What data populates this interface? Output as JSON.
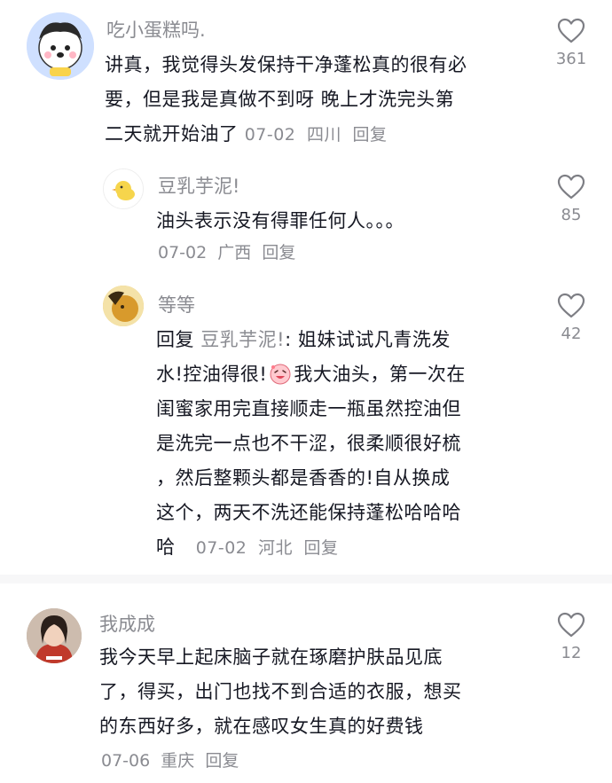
{
  "comments": [
    {
      "username": "吃小蛋糕吗.",
      "lines": [
        "讲真，我觉得头发保持干净蓬松真的很有必",
        "要，但是我是真做不到呀 晚上才洗完头第",
        "二天就开始油了"
      ],
      "date": "07-02",
      "location": "四川",
      "reply_label": "回复",
      "likes": "361"
    },
    {
      "username": "豆乳芋泥!",
      "lines": [
        "油头表示没有得罪任何人。。。"
      ],
      "date": "07-02",
      "location": "广西",
      "reply_label": "回复",
      "likes": "85"
    },
    {
      "username": "等等",
      "reply_prefix": "回复",
      "mention": "豆乳芋泥!",
      "lines": [
        ": 姐妹试试凡青洗发",
        "水!控油得很!",
        "我大油头，第一次在",
        "闺蜜家用完直接顺走一瓶虽然控油但",
        "是洗完一点也不干涩，很柔顺很好梳",
        "，然后整颗头都是香香的!自从换成",
        "这个，两天不洗还能保持蓬松哈哈哈",
        "哈"
      ],
      "date": "07-02",
      "location": "河北",
      "reply_label": "回复",
      "likes": "42"
    },
    {
      "username": "我成成",
      "lines": [
        "我今天早上起床脑子就在琢磨护肤品见底",
        "了，得买，出门也找不到合适的衣服，想买",
        "的东西好多，就在感叹女生真的好费钱"
      ],
      "date": "07-06",
      "location": "重庆",
      "reply_label": "回复",
      "likes": "12"
    }
  ],
  "icons": {
    "like": "heart-outline-icon",
    "inline_emoji": "laughing-emoji-icon"
  },
  "colors": {
    "text": "#161823",
    "meta": "#8a8b91",
    "divider": "#f7f7f8"
  }
}
